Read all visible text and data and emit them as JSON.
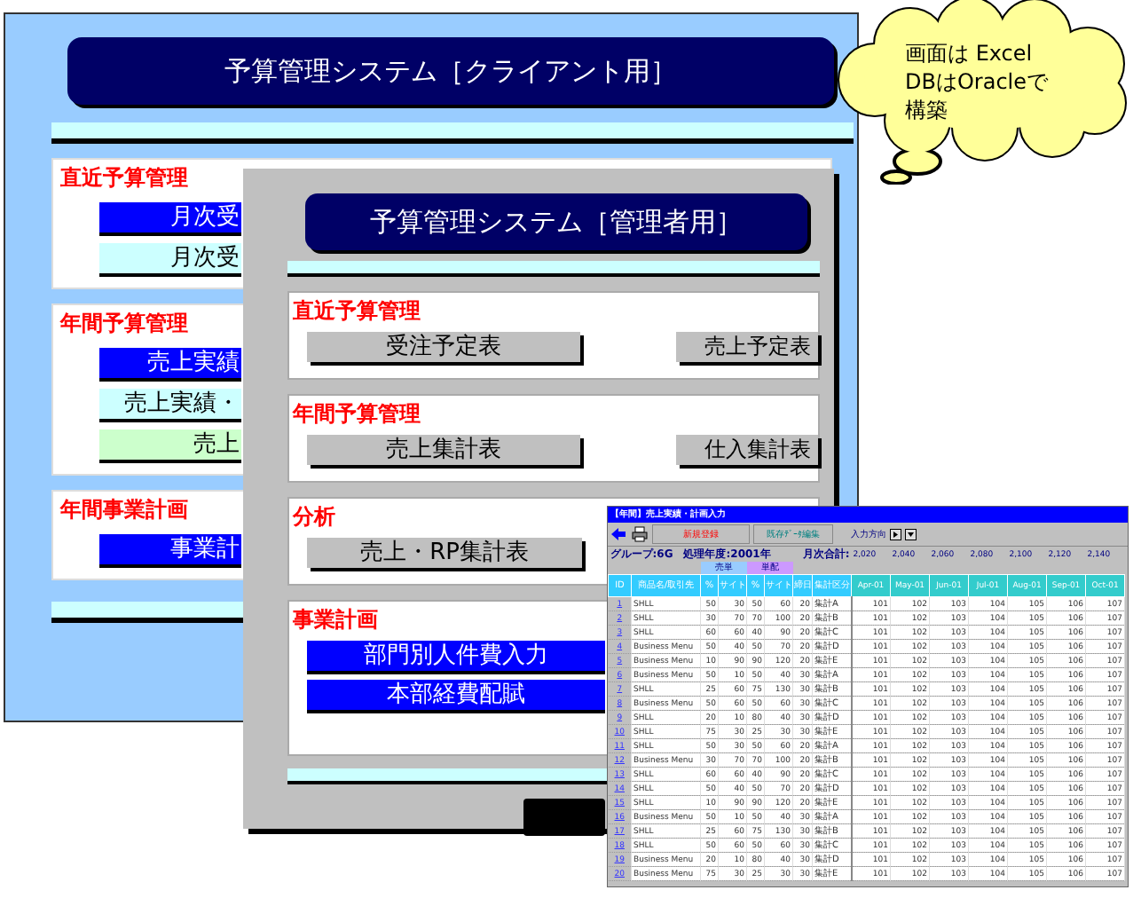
{
  "client_window": {
    "title": "予算管理システム［クライアント用］",
    "sections": [
      {
        "heading": "直近予算管理",
        "buttons": [
          {
            "label": "月次受",
            "color": "#0000ff"
          },
          {
            "label": "月次受",
            "color": "#ccffff"
          }
        ]
      },
      {
        "heading": "年間予算管理",
        "buttons": [
          {
            "label": "売上実績",
            "color": "#0000ff"
          },
          {
            "label": "売上実績・",
            "color": "#ccffff"
          },
          {
            "label": "売上",
            "color": "#ccffcc"
          }
        ]
      },
      {
        "heading": "年間事業計画",
        "buttons": [
          {
            "label": "事業計",
            "color": "#0000ff"
          }
        ]
      }
    ]
  },
  "admin_window": {
    "title": "予算管理システム［管理者用］",
    "sections": [
      {
        "heading": "直近予算管理",
        "buttons": [
          {
            "label": "受注予定表",
            "color": "#c0c0c0"
          },
          {
            "label": "売上予定表",
            "color": "#c0c0c0"
          }
        ]
      },
      {
        "heading": "年間予算管理",
        "buttons": [
          {
            "label": "売上集計表",
            "color": "#c0c0c0"
          },
          {
            "label": "仕入集計表",
            "color": "#c0c0c0"
          }
        ]
      },
      {
        "heading": "分析",
        "buttons": [
          {
            "label": "売上・RP集計表",
            "color": "#c0c0c0"
          }
        ]
      },
      {
        "heading": "事業計画",
        "buttons": [
          {
            "label": "部門別人件費入力",
            "color": "#0000ff"
          },
          {
            "label": "本部経費配賦",
            "color": "#0000ff"
          }
        ]
      }
    ]
  },
  "sheet_window": {
    "title": "【年間】売上実績・計画入力",
    "new_button": "新規登録",
    "edit_button": "既存ﾃﾞｰﾀ編集",
    "direction_label": "入力方向",
    "info": "グループ:6G　処理年度:2001年",
    "totals_label": "月次合計:",
    "totals": [
      "2,020",
      "2,040",
      "2,060",
      "2,080",
      "2,100",
      "2,120",
      "2,140"
    ],
    "group_headers": [
      {
        "label": "売単",
        "color": "#99ccff"
      },
      {
        "label": "単配",
        "color": "#cc99ff"
      }
    ],
    "columns": [
      "ID",
      "商品名/取引先",
      "%",
      "サイト",
      "%",
      "サイト",
      "締日",
      "集計区分",
      "Apr-01",
      "May-01",
      "Jun-01",
      "Jul-01",
      "Aug-01",
      "Sep-01",
      "Oct-01"
    ],
    "rows": [
      [
        "1",
        "SHLL",
        "50",
        "30",
        "50",
        "60",
        "20",
        "集計A",
        "101",
        "102",
        "103",
        "104",
        "105",
        "106",
        "107"
      ],
      [
        "2",
        "SHLL",
        "30",
        "70",
        "70",
        "100",
        "20",
        "集計B",
        "101",
        "102",
        "103",
        "104",
        "105",
        "106",
        "107"
      ],
      [
        "3",
        "SHLL",
        "60",
        "60",
        "40",
        "90",
        "20",
        "集計C",
        "101",
        "102",
        "103",
        "104",
        "105",
        "106",
        "107"
      ],
      [
        "4",
        "Business Menu",
        "50",
        "40",
        "50",
        "70",
        "20",
        "集計D",
        "101",
        "102",
        "103",
        "104",
        "105",
        "106",
        "107"
      ],
      [
        "5",
        "Business Menu",
        "10",
        "90",
        "90",
        "120",
        "20",
        "集計E",
        "101",
        "102",
        "103",
        "104",
        "105",
        "106",
        "107"
      ],
      [
        "6",
        "Business Menu",
        "50",
        "10",
        "50",
        "40",
        "30",
        "集計A",
        "101",
        "102",
        "103",
        "104",
        "105",
        "106",
        "107"
      ],
      [
        "7",
        "SHLL",
        "25",
        "60",
        "75",
        "130",
        "30",
        "集計B",
        "101",
        "102",
        "103",
        "104",
        "105",
        "106",
        "107"
      ],
      [
        "8",
        "Business Menu",
        "50",
        "60",
        "50",
        "60",
        "30",
        "集計C",
        "101",
        "102",
        "103",
        "104",
        "105",
        "106",
        "107"
      ],
      [
        "9",
        "SHLL",
        "20",
        "10",
        "80",
        "40",
        "30",
        "集計D",
        "101",
        "102",
        "103",
        "104",
        "105",
        "106",
        "107"
      ],
      [
        "10",
        "SHLL",
        "75",
        "30",
        "25",
        "30",
        "30",
        "集計E",
        "101",
        "102",
        "103",
        "104",
        "105",
        "106",
        "107"
      ],
      [
        "11",
        "SHLL",
        "50",
        "30",
        "50",
        "60",
        "20",
        "集計A",
        "101",
        "102",
        "103",
        "104",
        "105",
        "106",
        "107"
      ],
      [
        "12",
        "Business Menu",
        "30",
        "70",
        "70",
        "100",
        "20",
        "集計B",
        "101",
        "102",
        "103",
        "104",
        "105",
        "106",
        "107"
      ],
      [
        "13",
        "SHLL",
        "60",
        "60",
        "40",
        "90",
        "20",
        "集計C",
        "101",
        "102",
        "103",
        "104",
        "105",
        "106",
        "107"
      ],
      [
        "14",
        "SHLL",
        "50",
        "40",
        "50",
        "70",
        "20",
        "集計D",
        "101",
        "102",
        "103",
        "104",
        "105",
        "106",
        "107"
      ],
      [
        "15",
        "SHLL",
        "10",
        "90",
        "90",
        "120",
        "20",
        "集計E",
        "101",
        "102",
        "103",
        "104",
        "105",
        "106",
        "107"
      ],
      [
        "16",
        "Business Menu",
        "50",
        "10",
        "50",
        "40",
        "30",
        "集計A",
        "101",
        "102",
        "103",
        "104",
        "105",
        "106",
        "107"
      ],
      [
        "17",
        "SHLL",
        "25",
        "60",
        "75",
        "130",
        "30",
        "集計B",
        "101",
        "102",
        "103",
        "104",
        "105",
        "106",
        "107"
      ],
      [
        "18",
        "SHLL",
        "50",
        "60",
        "50",
        "60",
        "30",
        "集計C",
        "101",
        "102",
        "103",
        "104",
        "105",
        "106",
        "107"
      ],
      [
        "19",
        "Business Menu",
        "20",
        "10",
        "80",
        "40",
        "30",
        "集計D",
        "101",
        "102",
        "103",
        "104",
        "105",
        "106",
        "107"
      ],
      [
        "20",
        "Business Menu",
        "75",
        "30",
        "25",
        "30",
        "30",
        "集計E",
        "101",
        "102",
        "103",
        "104",
        "105",
        "106",
        "107"
      ]
    ]
  },
  "callout": {
    "lines": [
      "画面は Excel",
      "DBはOracleで",
      "構築"
    ]
  }
}
